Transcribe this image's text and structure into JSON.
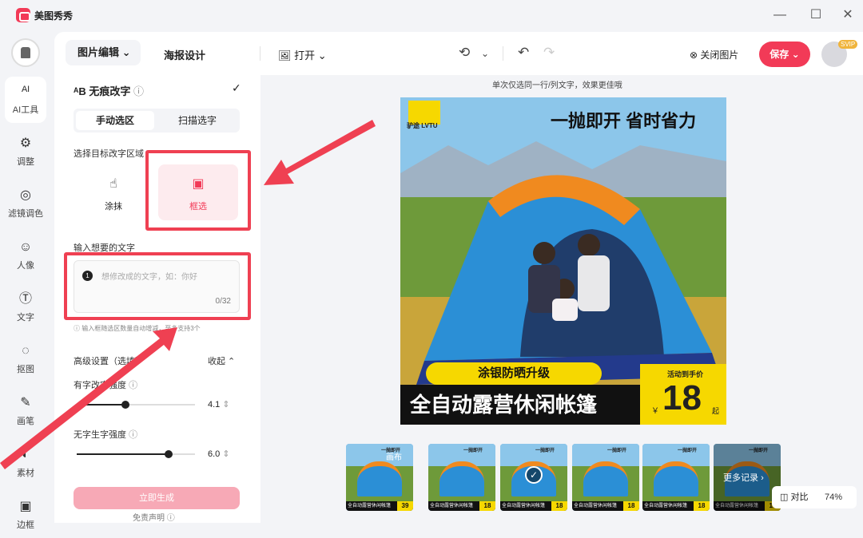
{
  "app": {
    "name": "美图秀秀"
  },
  "window": {
    "minimize": "—",
    "maximize": "☐",
    "close": "✕"
  },
  "sidebar": {
    "items": [
      {
        "label": "AI工具",
        "icon": "ai-icon",
        "glyph": "ᴬᴵ"
      },
      {
        "label": "调整",
        "icon": "adjust-icon",
        "glyph": "⚙"
      },
      {
        "label": "滤镜调色",
        "icon": "filter-icon",
        "glyph": "◎"
      },
      {
        "label": "人像",
        "icon": "portrait-icon",
        "glyph": "☺"
      },
      {
        "label": "文字",
        "icon": "text-icon",
        "glyph": "Ⓣ"
      },
      {
        "label": "抠图",
        "icon": "cutout-icon",
        "glyph": "◌"
      },
      {
        "label": "画笔",
        "icon": "brush-icon",
        "glyph": "✎"
      },
      {
        "label": "素材",
        "icon": "sticker-icon",
        "glyph": "◐"
      },
      {
        "label": "边框",
        "icon": "frame-icon",
        "glyph": "▣"
      }
    ]
  },
  "toolbar": {
    "tab_active": "图片编辑",
    "tab_other": "海报设计",
    "open": "打开",
    "close_image": "关闭图片",
    "save": "保存",
    "vip": "SVIP"
  },
  "panel": {
    "title": "无痕改字",
    "mode_manual": "手动选区",
    "mode_scan": "扫描选字",
    "select_label": "选择目标改字区域",
    "opt_smear": "涂抹",
    "opt_box": "框选",
    "input_label": "输入想要的文字",
    "input_placeholder": "想修改成的文字，如：你好",
    "counter": "0/32",
    "hint": "输入框随选区数量自动增减，至多支持3个",
    "advanced": "高级设置（选填）",
    "collapse": "收起",
    "slider1_label": "有字改字强度",
    "slider1_value": "4.1",
    "slider1_pct": 0.41,
    "slider2_label": "无字生字强度",
    "slider2_value": "6.0",
    "slider2_pct": 0.78,
    "generate": "立即生成",
    "disclaimer": "免责声明"
  },
  "canvas": {
    "note": "单次仅选同一行/列文字，效果更佳哦",
    "poster": {
      "brand": "驴途 LVTU",
      "headline": "一抛即开  省时省力",
      "badge": "涂银防晒升级",
      "title": "全自动露营休闲帐篷",
      "promo": "活动到手价",
      "currency": "￥",
      "price": "18",
      "unit": "起"
    },
    "thumbs": [
      {
        "top": "一抛即开",
        "caption": "全自动露营休闲帐篷",
        "price": "39",
        "tag": "画布"
      },
      {
        "top": "一抛即开",
        "caption": "全自动露营休闲帐篷",
        "price": "18",
        "tag": ""
      },
      {
        "top": "一抛即开",
        "caption": "全自动露营休闲帐篷",
        "price": "18",
        "tag": ""
      },
      {
        "top": "一抛即开",
        "caption": "全自动露营休闲帐篷",
        "price": "18",
        "tag": ""
      },
      {
        "top": "一抛即开",
        "caption": "全自动露营休闲帐篷",
        "price": "18",
        "tag": ""
      },
      {
        "top": "一抛即开",
        "caption": "全自动露营休闲帐篷",
        "price": "18",
        "tag": "更多记录"
      }
    ],
    "compare": "对比",
    "zoom": "74%"
  },
  "colors": {
    "accent": "#f23a57",
    "highlight": "#ef4052",
    "price_bg": "#f6d800"
  }
}
